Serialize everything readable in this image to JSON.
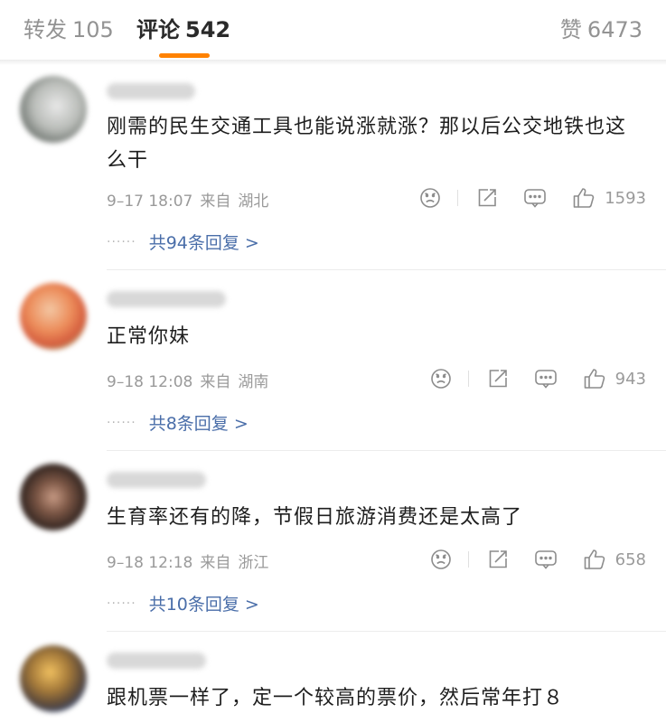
{
  "tabs": {
    "reposts": {
      "label": "转发",
      "count": "105"
    },
    "comments": {
      "label": "评论",
      "count": "542"
    },
    "likes": {
      "label": "赞",
      "count": "6473"
    }
  },
  "comments": [
    {
      "text": "刚需的民生交通工具也能说涨就涨？那以后公交地铁也这么干",
      "time": "9–17 18:07",
      "from": "来自",
      "location": "湖北",
      "likes": "1593",
      "replies": "共94条回复 >"
    },
    {
      "text": "正常你妹",
      "time": "9–18 12:08",
      "from": "来自",
      "location": "湖南",
      "likes": "943",
      "replies": "共8条回复 >"
    },
    {
      "text": "生育率还有的降，节假日旅游消费还是太高了",
      "time": "9–18 12:18",
      "from": "来自",
      "location": "浙江",
      "likes": "658",
      "replies": "共10条回复 >"
    },
    {
      "text": "跟机票一样了，定一个较高的票价，然后常年打８"
    }
  ],
  "reply_dots": "······",
  "colors": {
    "accent": "#ff8200",
    "link": "#4a6ea9",
    "muted": "#9a9a9a"
  }
}
